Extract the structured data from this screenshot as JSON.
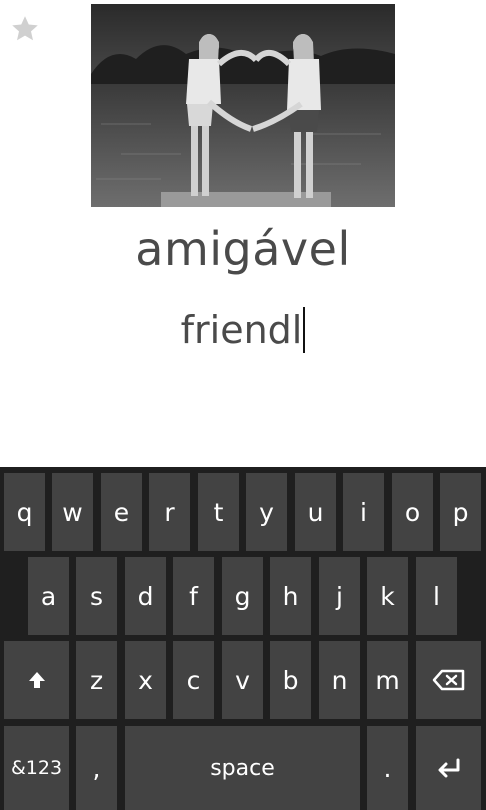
{
  "card": {
    "favorite_icon": "star-icon",
    "photo_description_icon": "heart-hands-photo",
    "word": "amigável",
    "answer_value": "friendl"
  },
  "keyboard": {
    "row1": [
      "q",
      "w",
      "e",
      "r",
      "t",
      "y",
      "u",
      "i",
      "o",
      "p"
    ],
    "row2": [
      "a",
      "s",
      "d",
      "f",
      "g",
      "h",
      "j",
      "k",
      "l"
    ],
    "row3_letters": [
      "z",
      "x",
      "c",
      "v",
      "b",
      "n",
      "m"
    ],
    "shift_icon": "shift-arrow-icon",
    "backspace_icon": "backspace-icon",
    "symbols_label": "&123",
    "comma_label": ",",
    "space_label": "space",
    "period_label": ".",
    "enter_icon": "enter-icon"
  },
  "colors": {
    "keyboard_bg": "#1f1f1f",
    "key_bg": "#434343",
    "text": "#4a4a4a"
  }
}
